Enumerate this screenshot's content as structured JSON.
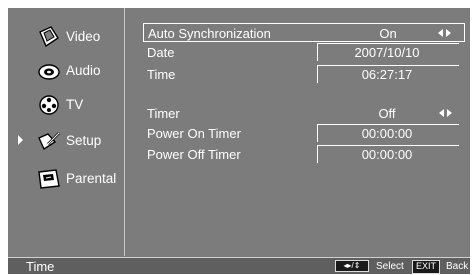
{
  "sidebar": {
    "items": [
      {
        "label": "Video",
        "icon": "video-icon"
      },
      {
        "label": "Audio",
        "icon": "audio-icon"
      },
      {
        "label": "TV",
        "icon": "tv-icon"
      },
      {
        "label": "Setup",
        "icon": "setup-icon",
        "selected": true
      },
      {
        "label": "Parental",
        "icon": "parental-icon"
      }
    ]
  },
  "settings": {
    "auto_sync": {
      "label": "Auto Synchronization",
      "value": "On"
    },
    "date": {
      "label": "Date",
      "value": "2007/10/10"
    },
    "time": {
      "label": "Time",
      "value": "06:27:17"
    },
    "timer": {
      "label": "Timer",
      "value": "Off"
    },
    "power_on_timer": {
      "label": "Power On Timer",
      "value": "00:00:00"
    },
    "power_off_timer": {
      "label": "Power Off Timer",
      "value": "00:00:00"
    }
  },
  "status_bar": {
    "title": "Time",
    "nav_key": "◂▸/⇕",
    "select_label": "Select",
    "exit_key": "EXIT",
    "back_label": "Back"
  },
  "colors": {
    "background": "#7c7c7c",
    "status_bar": "#5f5f5f",
    "text": "#ffffff"
  }
}
